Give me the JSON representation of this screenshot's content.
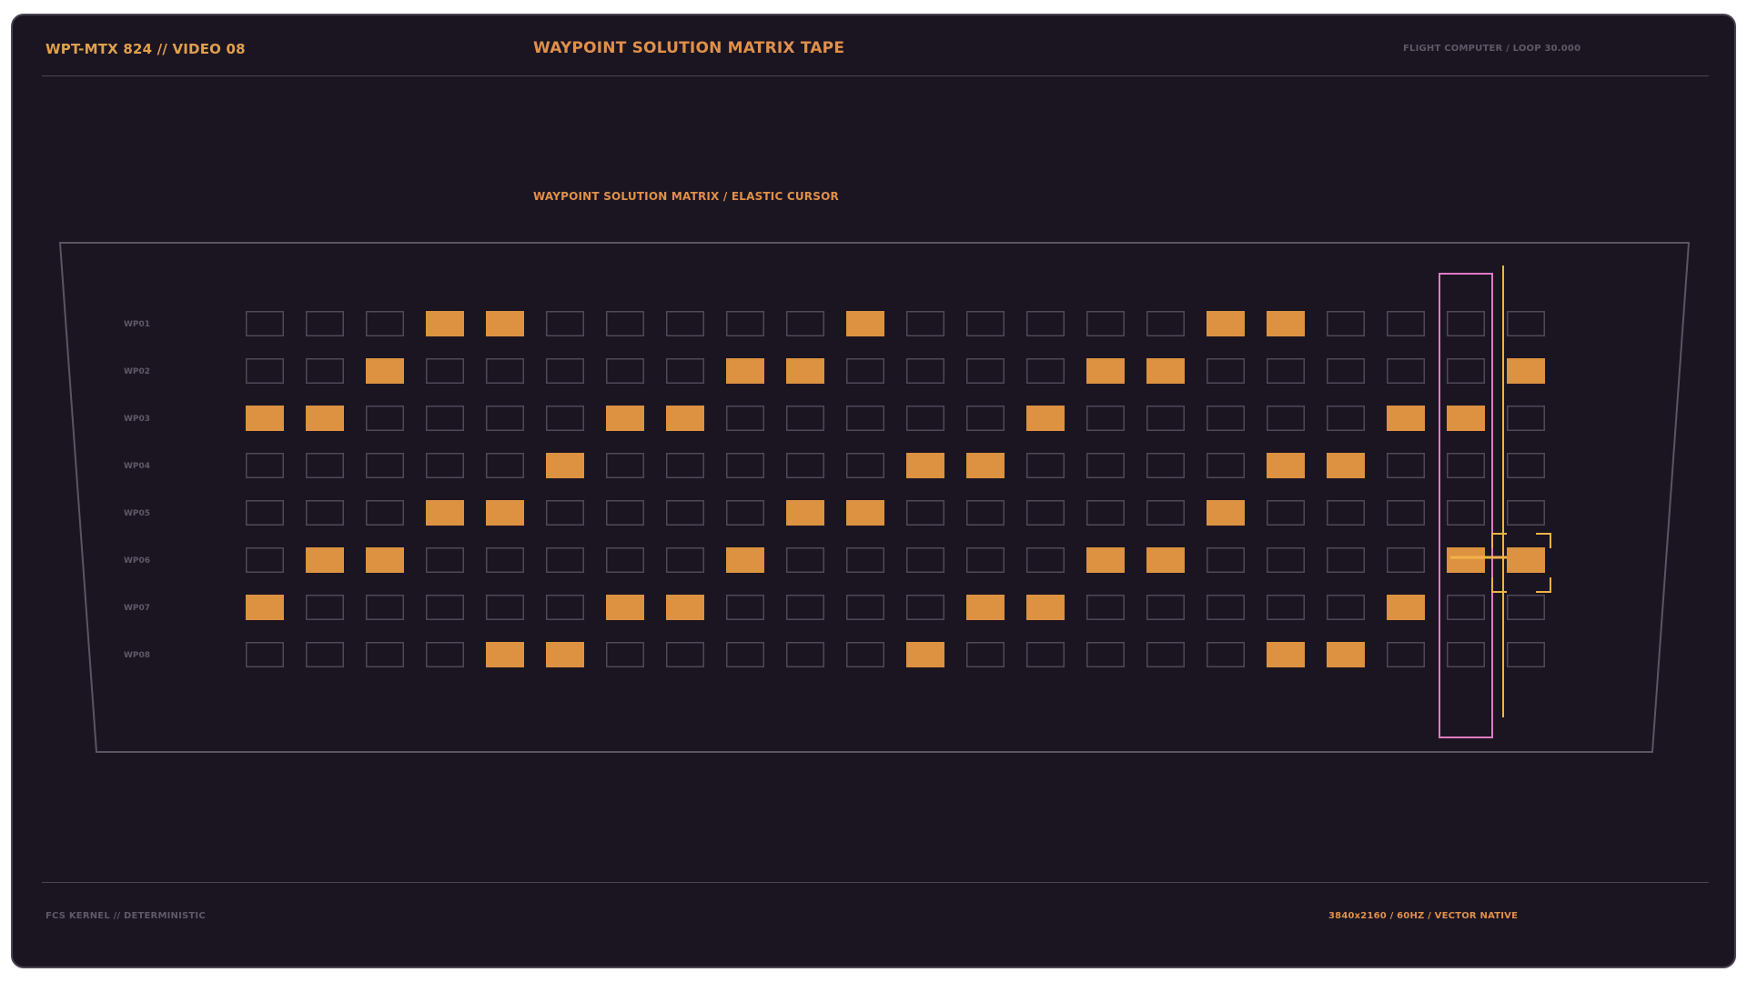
{
  "header": {
    "left": "WPT-MTX 824 // VIDEO 08",
    "title": "WAYPOINT SOLUTION MATRIX TAPE",
    "right": "FLIGHT COMPUTER / LOOP 30.000"
  },
  "panel": {
    "subtitle": "WAYPOINT SOLUTION MATRIX / ELASTIC CURSOR"
  },
  "footer": {
    "left": "FCS KERNEL // DETERMINISTIC",
    "right": "3840x2160 / 60HZ / VECTOR NATIVE"
  },
  "matrix": {
    "rows": [
      {
        "label": "WP01",
        "cells": [
          0,
          0,
          0,
          1,
          1,
          0,
          0,
          0,
          0,
          0,
          1,
          0,
          0,
          0,
          0,
          0,
          1,
          1,
          0,
          0,
          0,
          0
        ]
      },
      {
        "label": "WP02",
        "cells": [
          0,
          0,
          1,
          0,
          0,
          0,
          0,
          0,
          1,
          1,
          0,
          0,
          0,
          0,
          1,
          1,
          0,
          0,
          0,
          0,
          0,
          1
        ]
      },
      {
        "label": "WP03",
        "cells": [
          1,
          1,
          0,
          0,
          0,
          0,
          1,
          1,
          0,
          0,
          0,
          0,
          0,
          1,
          0,
          0,
          0,
          0,
          0,
          1,
          1,
          0
        ]
      },
      {
        "label": "WP04",
        "cells": [
          0,
          0,
          0,
          0,
          0,
          1,
          0,
          0,
          0,
          0,
          0,
          1,
          1,
          0,
          0,
          0,
          0,
          1,
          1,
          0,
          0,
          0
        ]
      },
      {
        "label": "WP05",
        "cells": [
          0,
          0,
          0,
          1,
          1,
          0,
          0,
          0,
          0,
          1,
          1,
          0,
          0,
          0,
          0,
          0,
          1,
          0,
          0,
          0,
          0,
          0
        ]
      },
      {
        "label": "WP06",
        "cells": [
          0,
          1,
          1,
          0,
          0,
          0,
          0,
          0,
          1,
          0,
          0,
          0,
          0,
          0,
          1,
          1,
          0,
          0,
          0,
          0,
          1,
          1
        ]
      },
      {
        "label": "WP07",
        "cells": [
          1,
          0,
          0,
          0,
          0,
          0,
          1,
          1,
          0,
          0,
          0,
          0,
          1,
          1,
          0,
          0,
          0,
          0,
          0,
          1,
          0,
          0
        ]
      },
      {
        "label": "WP08",
        "cells": [
          0,
          0,
          0,
          0,
          1,
          1,
          0,
          0,
          0,
          0,
          0,
          1,
          0,
          0,
          0,
          0,
          0,
          1,
          1,
          0,
          0,
          0
        ]
      }
    ],
    "highlight_column": 20,
    "cursor_column": 21,
    "cursor_row": 5
  },
  "colors": {
    "background": "#1b1522",
    "accent": "#e0904a",
    "cell_on": "#dc9240",
    "cell_off_stroke": "#4e4958",
    "highlight": "#e07ac4",
    "cursor": "#f2b24a",
    "muted_text": "#5e5868"
  }
}
